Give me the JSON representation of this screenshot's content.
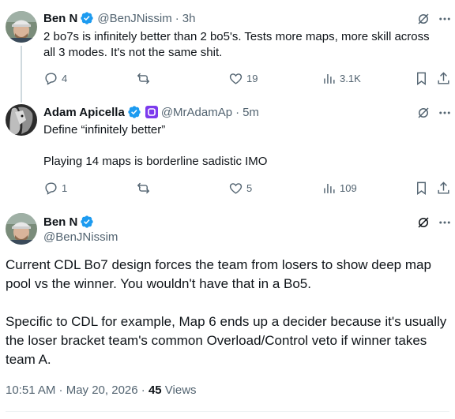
{
  "tweets": [
    {
      "name": "Ben N",
      "handle": "@BenJNissim",
      "time": "3h",
      "text": "2 bo7s is infinitely better than 2 bo5's. Tests more maps, more skill across all 3 modes. It's not the same shit.",
      "replies": "4",
      "retweets": "",
      "likes": "19",
      "views": "3.1K"
    },
    {
      "name": "Adam Apicella",
      "handle": "@MrAdamAp",
      "time": "5m",
      "line1": "Define “infinitely better”",
      "line2": "Playing 14 maps is borderline sadistic IMO",
      "replies": "1",
      "retweets": "",
      "likes": "5",
      "views": "109"
    }
  ],
  "main": {
    "name": "Ben N",
    "handle": "@BenJNissim",
    "para1": "Current CDL Bo7 design forces the team from losers to show deep map pool vs the winner. You wouldn't have that in a Bo5.",
    "para2": "Specific to CDL for example, Map 6 ends up  a decider because it's usually the loser bracket team's common Overload/Control veto if winner takes team A.",
    "timestamp": "10:51 AM · May 20, 2026 · ",
    "views_count": "45",
    "views_label": " Views"
  },
  "colors": {
    "verified": "#1d9bf0",
    "secondary_text": "#536471",
    "affiliate_badge": "#7c3aed"
  },
  "icons": [
    "verified-badge-icon",
    "grok-icon",
    "more-icon",
    "reply-icon",
    "retweet-icon",
    "like-icon",
    "views-icon",
    "bookmark-icon",
    "share-icon"
  ]
}
